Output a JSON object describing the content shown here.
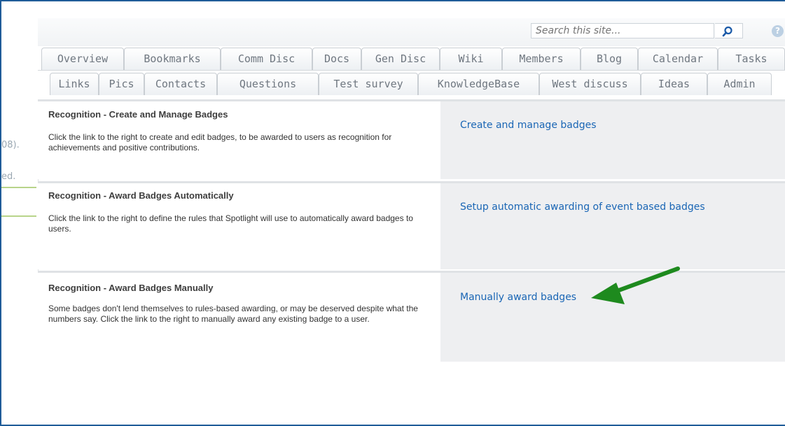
{
  "search": {
    "placeholder": "Search this site...",
    "icon": "search-icon"
  },
  "help": {
    "glyph": "?"
  },
  "tabs_row1": [
    "Overview",
    "Bookmarks",
    "Comm Disc",
    "Docs",
    "Gen Disc",
    "Wiki",
    "Members",
    "Blog",
    "Calendar",
    "Tasks"
  ],
  "tabs_row2": [
    "Links",
    "Pics",
    "Contacts",
    "Questions",
    "Test survey",
    "KnowledgeBase",
    "West discuss",
    "Ideas",
    "Admin"
  ],
  "left_remnants": [
    "08).",
    "ed."
  ],
  "sections": [
    {
      "title": "Recognition - Create and Manage Badges",
      "description": "Click the link to the right to create and edit badges, to be awarded to users as recognition for achievements and positive contributions.",
      "link": "Create and manage badges"
    },
    {
      "title": "Recognition - Award Badges Automatically",
      "description": "Click the link to the right to define the rules that Spotlight will use to automatically award badges to users.",
      "link": "Setup automatic awarding of event based badges"
    },
    {
      "title": "Recognition - Award Badges Manually",
      "description": "Some badges don't lend themselves to rules-based awarding, or may be deserved despite what the numbers say.  Click the link to the right to manually award any existing badge to a user.",
      "link": "Manually award badges"
    }
  ],
  "colors": {
    "link": "#1a66b5",
    "arrow": "#1e8a1e",
    "frame": "#1f5c99"
  }
}
